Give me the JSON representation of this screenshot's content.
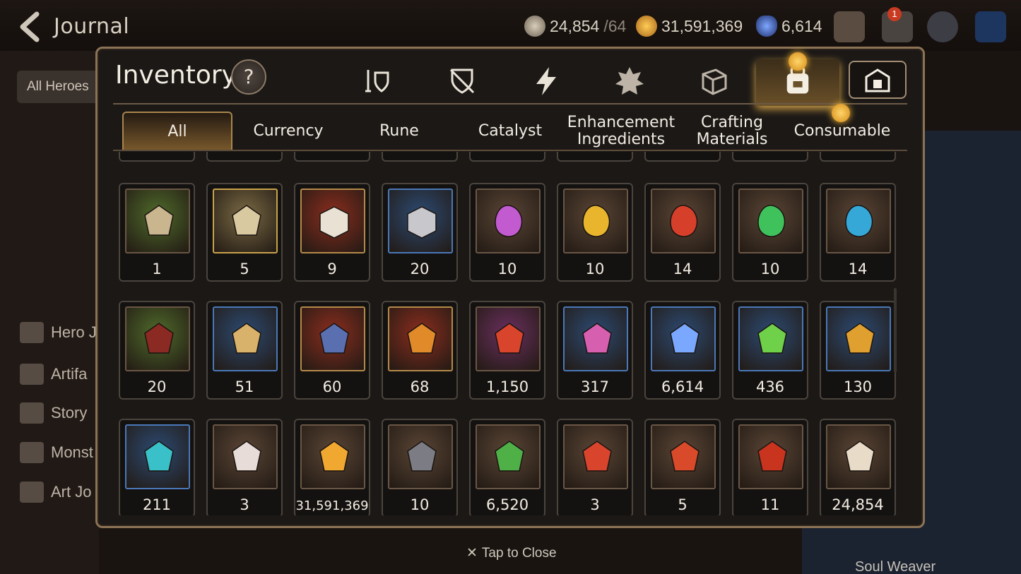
{
  "header": {
    "title": "Journal",
    "resources": [
      {
        "icon": "stamina-icon",
        "value": "24,854",
        "suffix": "/64"
      },
      {
        "icon": "gold-icon",
        "value": "31,591,369"
      },
      {
        "icon": "skystone-icon",
        "value": "6,614"
      }
    ],
    "mail_badge": "1"
  },
  "sidebar": {
    "filter": "All Heroes",
    "items": [
      "Hero J",
      "Artifa",
      "Story",
      "Monst",
      "Art Jo"
    ]
  },
  "background": {
    "hero_label": "Hero",
    "soul_weaver": "Soul Weaver",
    "tap_close": "Tap to Close"
  },
  "modal": {
    "title": "Inventory",
    "help": "?",
    "category_icons": [
      "hero-gear-icon",
      "shield-icon",
      "artifact-icon",
      "rune-icon",
      "material-box-icon",
      "bag-icon",
      "storage-icon"
    ],
    "tabs": [
      {
        "label": "All",
        "active": true
      },
      {
        "label": "Currency"
      },
      {
        "label": "Rune"
      },
      {
        "label": "Catalyst"
      },
      {
        "label": "Enhancement Ingredients"
      },
      {
        "label": "Crafting Materials"
      },
      {
        "label": "Consumable"
      }
    ],
    "rows": [
      [
        {
          "qty": "1",
          "icon": "rune-stone-icon",
          "frame": "green"
        },
        {
          "qty": "5",
          "icon": "rune-stone-gold-icon",
          "frame": "gold"
        },
        {
          "qty": "9",
          "icon": "treasure-box-icon",
          "frame": "red"
        },
        {
          "qty": "20",
          "icon": "gear-box-icon",
          "frame": "blue"
        },
        {
          "qty": "10",
          "icon": "purple-gem-icon",
          "frame": "brown"
        },
        {
          "qty": "10",
          "icon": "yellow-gem-icon",
          "frame": "brown"
        },
        {
          "qty": "14",
          "icon": "red-gem-icon",
          "frame": "brown"
        },
        {
          "qty": "10",
          "icon": "green-gem-icon",
          "frame": "brown"
        },
        {
          "qty": "14",
          "icon": "blue-gem-icon",
          "frame": "brown"
        }
      ],
      [
        {
          "qty": "20",
          "icon": "claw-icon",
          "frame": "green"
        },
        {
          "qty": "51",
          "icon": "root-icon",
          "frame": "blue"
        },
        {
          "qty": "60",
          "icon": "ring-icon",
          "frame": "red"
        },
        {
          "qty": "68",
          "icon": "crystal-icon",
          "frame": "red"
        },
        {
          "qty": "1,150",
          "icon": "flower-ring-icon",
          "frame": "purple"
        },
        {
          "qty": "317",
          "icon": "pink-mountain-icon",
          "frame": "blue"
        },
        {
          "qty": "6,614",
          "icon": "skystone-icon",
          "frame": "blue"
        },
        {
          "qty": "436",
          "icon": "leaf-icon",
          "frame": "blue"
        },
        {
          "qty": "130",
          "icon": "star-amulet-icon",
          "frame": "blue"
        }
      ],
      [
        {
          "qty": "211",
          "icon": "prism-icon",
          "frame": "blue"
        },
        {
          "qty": "3",
          "icon": "pet-egg-icon",
          "frame": "brown"
        },
        {
          "qty": "31,591,369",
          "icon": "gold-coin-icon",
          "frame": "brown"
        },
        {
          "qty": "10",
          "icon": "stone-compass-icon",
          "frame": "brown"
        },
        {
          "qty": "6,520",
          "icon": "green-heart-icon",
          "frame": "brown"
        },
        {
          "qty": "3",
          "icon": "red-badge-icon",
          "frame": "brown"
        },
        {
          "qty": "5",
          "icon": "banner-icon",
          "frame": "brown"
        },
        {
          "qty": "11",
          "icon": "red-leaf-icon",
          "frame": "brown"
        },
        {
          "qty": "24,854",
          "icon": "knight-piece-icon",
          "frame": "brown"
        }
      ]
    ],
    "colors": {
      "green": "#4f6a2a",
      "gold": "#7a6a44",
      "red": "#8a2d1e",
      "blue": "#2c4a72",
      "brown": "#5a4535",
      "purple": "#6a2f5e"
    }
  }
}
